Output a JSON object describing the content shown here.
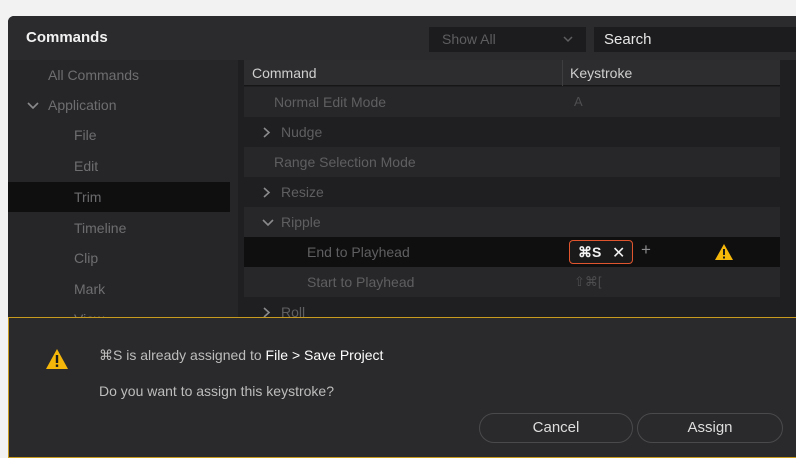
{
  "header": {
    "title": "Commands",
    "filter_value": "Show All",
    "search_value": "Search"
  },
  "sidebar": {
    "items": [
      {
        "label": "All Commands"
      },
      {
        "label": "Application"
      },
      {
        "label": "File"
      },
      {
        "label": "Edit"
      },
      {
        "label": "Trim"
      },
      {
        "label": "Timeline"
      },
      {
        "label": "Clip"
      },
      {
        "label": "Mark"
      },
      {
        "label": "View"
      }
    ]
  },
  "table": {
    "columns": [
      "Command",
      "Keystroke"
    ],
    "rows": [
      {
        "command": "Normal Edit Mode",
        "keystroke": "A"
      },
      {
        "command": "Nudge",
        "keystroke": ""
      },
      {
        "command": "Range Selection Mode",
        "keystroke": ""
      },
      {
        "command": "Resize",
        "keystroke": ""
      },
      {
        "command": "Ripple",
        "keystroke": ""
      },
      {
        "command": "End to Playhead",
        "keystroke": "⌘S"
      },
      {
        "command": "Start to Playhead",
        "keystroke": "⇧⌘["
      },
      {
        "command": "Roll",
        "keystroke": ""
      }
    ],
    "chip_remove": "✕",
    "add_symbol": "+"
  },
  "dialog": {
    "message_prefix": "⌘S is already assigned to ",
    "message_target": "File > Save Project",
    "question": "Do you want to assign this keystroke?",
    "cancel_label": "Cancel",
    "assign_label": "Assign"
  },
  "colors": {
    "accent_warning": "#f5b70a",
    "conflict_border": "#e0552e",
    "dialog_border": "#c89a1e"
  }
}
